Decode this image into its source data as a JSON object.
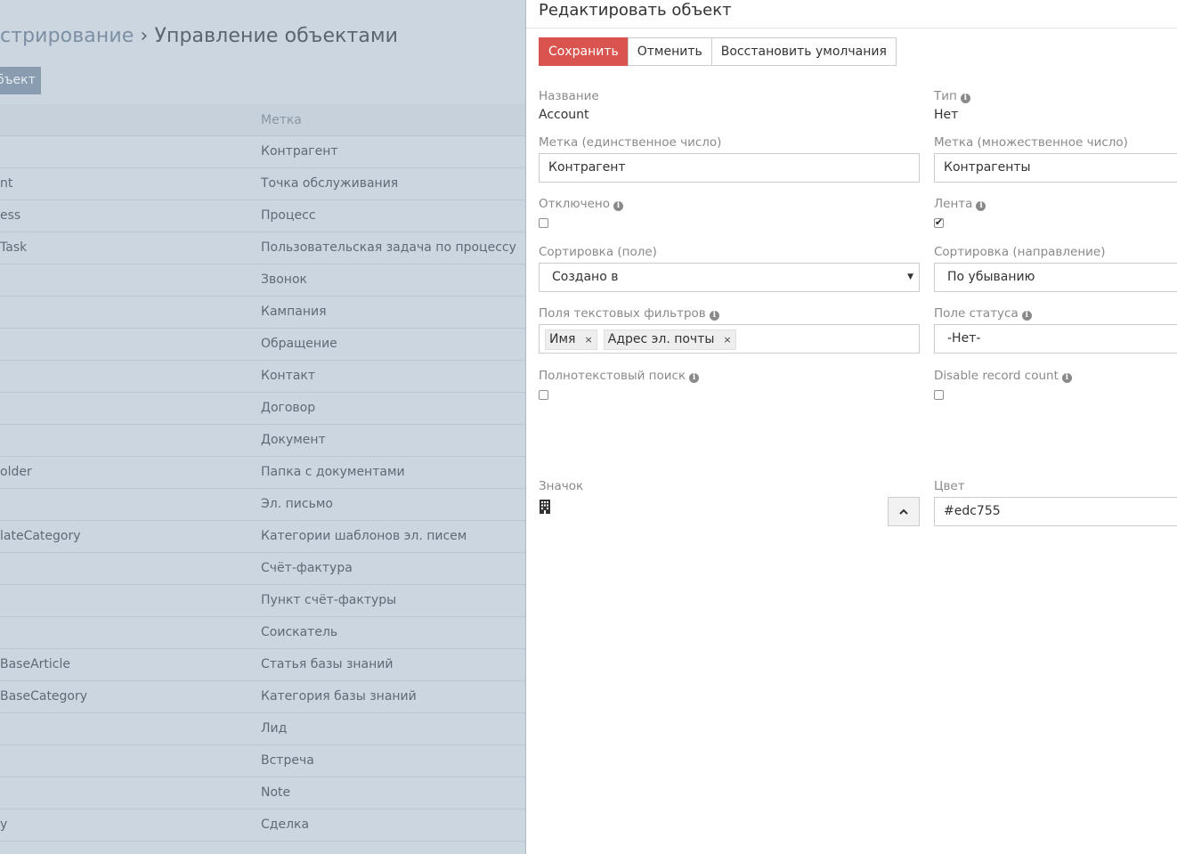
{
  "background": {
    "breadcrumb_parent": "стрирование",
    "breadcrumb_sep": "›",
    "breadcrumb_current": "Управление объектами",
    "create_button": "бъект",
    "table_header_label": "Метка",
    "rows": [
      {
        "name": "",
        "label": "Контрагент"
      },
      {
        "name": "nt",
        "label": "Точка обслуживания"
      },
      {
        "name": "ess",
        "label": "Процесс"
      },
      {
        "name": "Task",
        "label": "Пользовательская задача по процессу"
      },
      {
        "name": "",
        "label": "Звонок"
      },
      {
        "name": "",
        "label": "Кампания"
      },
      {
        "name": "",
        "label": "Обращение"
      },
      {
        "name": "",
        "label": "Контакт"
      },
      {
        "name": "",
        "label": "Договор"
      },
      {
        "name": "",
        "label": "Документ"
      },
      {
        "name": "older",
        "label": "Папка с документами"
      },
      {
        "name": "",
        "label": "Эл. письмо"
      },
      {
        "name": "lateCategory",
        "label": "Категории шаблонов эл. писем"
      },
      {
        "name": "",
        "label": "Счёт-фактура"
      },
      {
        "name": "",
        "label": "Пункт счёт-фактуры"
      },
      {
        "name": "",
        "label": "Соискатель"
      },
      {
        "name": "BaseArticle",
        "label": "Статья базы знаний"
      },
      {
        "name": "BaseCategory",
        "label": "Категория базы знаний"
      },
      {
        "name": "",
        "label": "Лид"
      },
      {
        "name": "",
        "label": "Встреча"
      },
      {
        "name": "",
        "label": "Note"
      },
      {
        "name": "y",
        "label": "Сделка"
      }
    ]
  },
  "modal": {
    "title": "Редактировать объект",
    "buttons": {
      "save": "Сохранить",
      "cancel": "Отменить",
      "reset": "Восстановить умолчания"
    },
    "name": {
      "label": "Название",
      "value": "Account"
    },
    "type": {
      "label": "Тип",
      "value": "Нет"
    },
    "label_singular": {
      "label": "Метка (единственное число)",
      "value": "Контрагент"
    },
    "label_plural": {
      "label": "Метка (множественное число)",
      "value": "Контрагенты"
    },
    "disabled": {
      "label": "Отключено",
      "checked": false
    },
    "stream": {
      "label": "Лента",
      "checked": true
    },
    "sort_field": {
      "label": "Сортировка (поле)",
      "value": "Создано в"
    },
    "sort_direction": {
      "label": "Сортировка (направление)",
      "value": "По убыванию"
    },
    "text_filter_fields": {
      "label": "Поля текстовых фильтров",
      "tags": [
        "Имя",
        "Адрес эл. почты"
      ],
      "remove_glyph": "×"
    },
    "status_field": {
      "label": "Поле статуса",
      "value": "-Нет-"
    },
    "fulltext": {
      "label": "Полнотекстовый поиск",
      "checked": false
    },
    "disable_count": {
      "label": "Disable record count",
      "checked": false
    },
    "icon": {
      "label": "Значок",
      "icon_name": "building-icon"
    },
    "color": {
      "label": "Цвет",
      "value": "#edc755"
    },
    "colors": {
      "save_bg": "#d9534f",
      "overlay_bg": "#ccd6e1"
    }
  }
}
